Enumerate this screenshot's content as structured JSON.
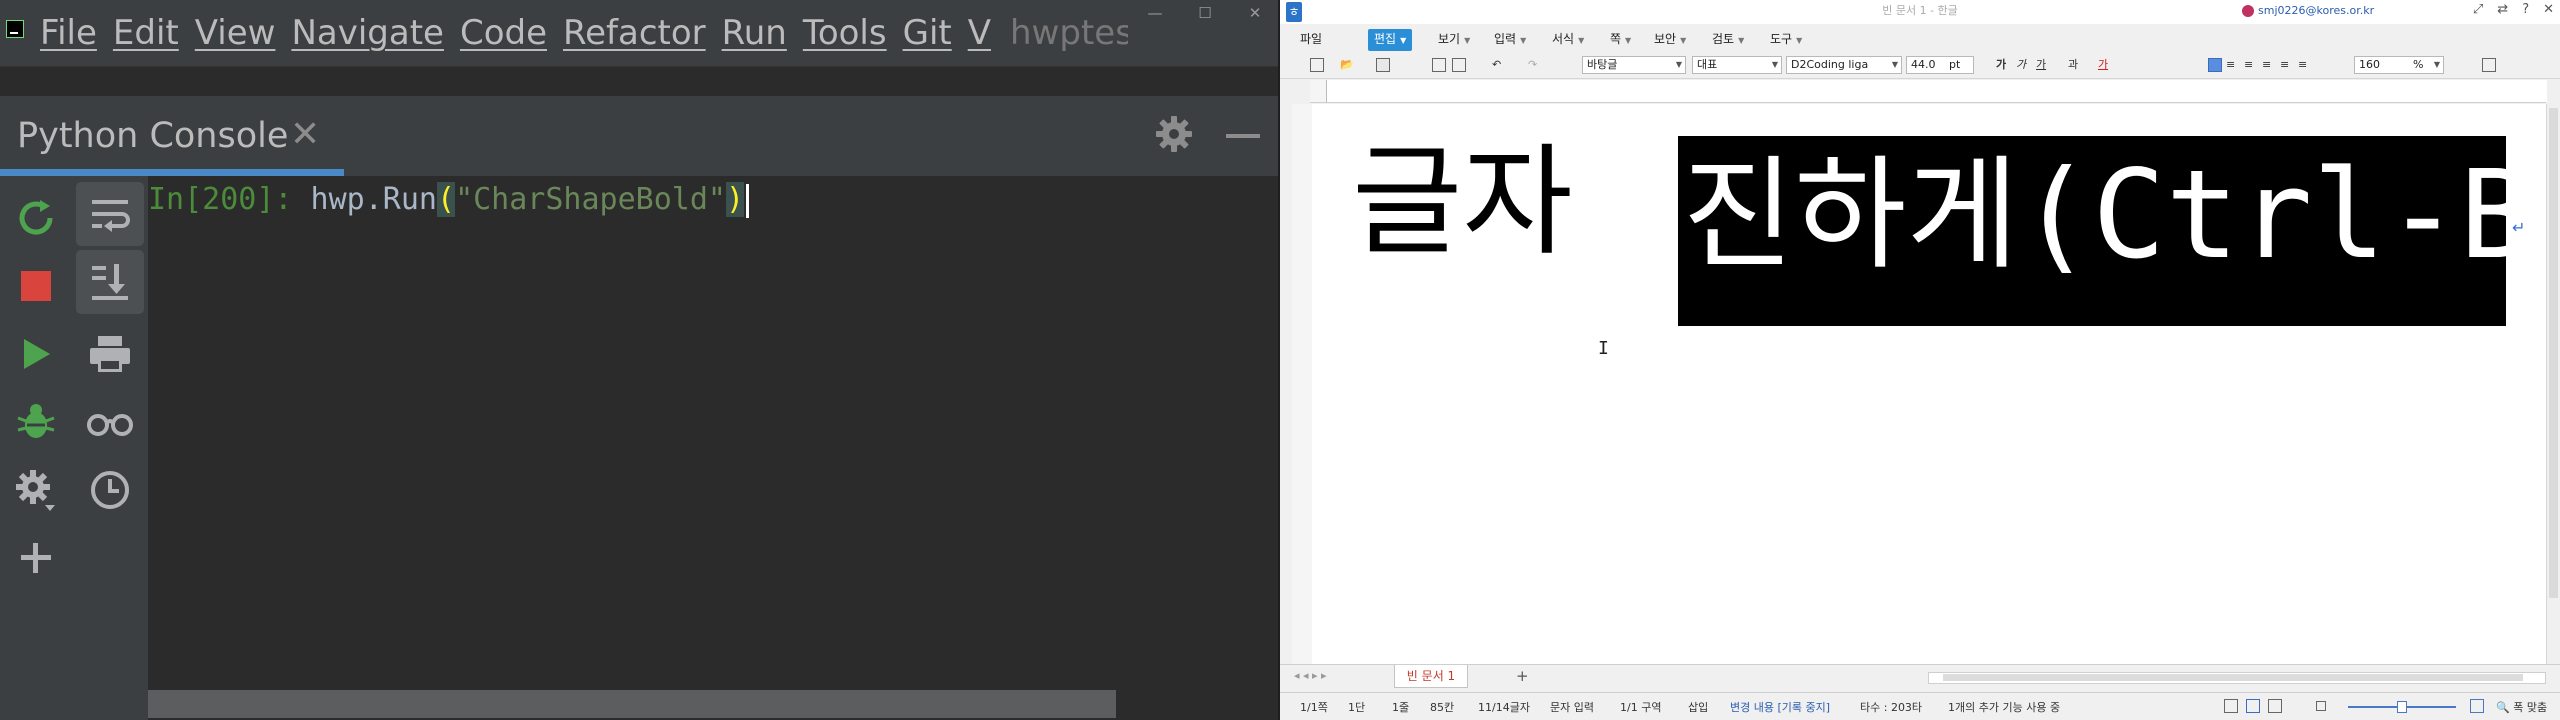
{
  "ide": {
    "menu": [
      "File",
      "Edit",
      "View",
      "Navigate",
      "Code",
      "Refactor",
      "Run",
      "Tools",
      "Git",
      "V"
    ],
    "project_name": "hwptest",
    "window_controls": [
      "—",
      "☐",
      "✕"
    ],
    "tool_window": {
      "title": "Python Console",
      "close": "✕"
    },
    "console": {
      "prompt": "In[200]:",
      "code_before": " hwp.Run",
      "paren_open": "(",
      "string": "\"CharShapeBold\"",
      "paren_close": ")"
    },
    "toolbar_left": [
      "rerun-icon",
      "stop-icon",
      "run-icon",
      "debug-icon",
      "settings-icon",
      "add-icon"
    ],
    "toolbar_right": [
      "soft-wrap-icon",
      "scroll-to-end-icon",
      "print-icon",
      "show-variables-icon",
      "history-icon"
    ],
    "colors": {
      "bg": "#2b2b2b",
      "panel": "#3c3f41",
      "accent": "#4a88c7",
      "green": "#4b8c3b",
      "string": "#6a8759"
    }
  },
  "hwp": {
    "title": "빈 문서 1 - 한글",
    "user_email": "smj0226@kores.or.kr",
    "title_controls": [
      "⤢",
      "⇄",
      "?",
      "✕"
    ],
    "menu": [
      {
        "label": "파일"
      },
      {
        "label": "편집",
        "selected": true
      },
      {
        "label": "보기"
      },
      {
        "label": "입력"
      },
      {
        "label": "서식"
      },
      {
        "label": "쪽"
      },
      {
        "label": "보안"
      },
      {
        "label": "검토"
      },
      {
        "label": "도구"
      }
    ],
    "toolbar": {
      "style": "바탕글",
      "language": "대표",
      "font": "D2Coding liga",
      "size": "44.0",
      "size_unit": "pt",
      "fmt_bold": "가",
      "fmt_italic": "가",
      "fmt_underline": "가",
      "fmt_strike": "과",
      "fmt_color": "가",
      "zoom": "160",
      "zoom_unit": "%"
    },
    "document": {
      "plain_text": "글자 ",
      "selected_text": "진하게(Ctrl-B)",
      "para_mark": "↵",
      "ibeam": "I"
    },
    "doc_tab": "빈 문서 1",
    "add_tab": "+",
    "statusbar": {
      "page": "1/1쪽",
      "column": "1단",
      "line": "1줄",
      "col_pos": "85칸",
      "chars": "11/14글자",
      "input_mode": "문자 입력",
      "section": "1/1 구역",
      "insert": "삽입",
      "track_changes": "변경 내용 [기록 중지]",
      "keystrokes": "타수 : 203타",
      "extra": "1개의 추가 기능 사용 중",
      "fit": "폭 맞춤"
    },
    "colors": {
      "selection": "#000000",
      "menu_selected": "#2a8fd6",
      "tab_text": "#c0392b"
    }
  }
}
